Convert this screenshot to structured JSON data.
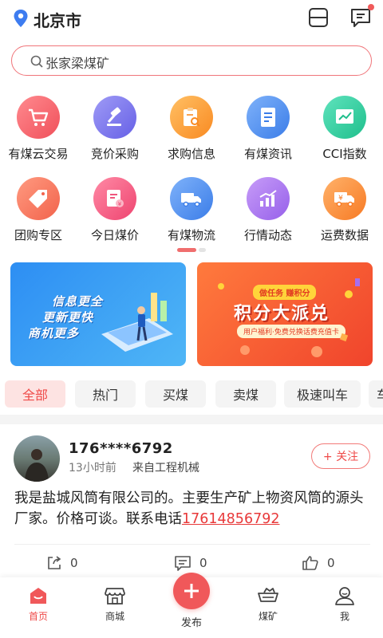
{
  "header": {
    "city": "北京市"
  },
  "search": {
    "text": "张家梁煤矿"
  },
  "grid": [
    {
      "label": "有煤云交易",
      "icon": "cart-icon",
      "color": "#f2616a"
    },
    {
      "label": "竞价采购",
      "icon": "gavel-icon",
      "color": "#7b75ee"
    },
    {
      "label": "求购信息",
      "icon": "clipboard-search-icon",
      "color": "#fb9b37"
    },
    {
      "label": "有煤资讯",
      "icon": "document-icon",
      "color": "#4f8ff0"
    },
    {
      "label": "CCI指数",
      "icon": "chart-window-icon",
      "color": "#2fcf9f"
    },
    {
      "label": "团购专区",
      "icon": "tag-icon",
      "color": "#f7775f"
    },
    {
      "label": "今日煤价",
      "icon": "price-doc-icon",
      "color": "#f25a7c"
    },
    {
      "label": "有煤物流",
      "icon": "truck-icon",
      "color": "#4f8ff0"
    },
    {
      "label": "行情动态",
      "icon": "bar-chart-icon",
      "color": "#a66ef0"
    },
    {
      "label": "运费数据",
      "icon": "freight-truck-icon",
      "color": "#fb8a3a"
    }
  ],
  "banners": {
    "left": [
      "信息更全",
      "更新更快",
      "商机更多"
    ],
    "right": {
      "pill": "做任务 赚积分",
      "title": "积分大派兑",
      "sub": "用户福利·免费兑换话费充值卡"
    }
  },
  "tabs": [
    "全部",
    "热门",
    "买煤",
    "卖煤",
    "极速叫车",
    "车"
  ],
  "post": {
    "username": "176****6792",
    "time": "13小时前",
    "source": "来自工程机械",
    "follow": "+ 关注",
    "content": "我是盐城风筒有限公司的。主要生产矿上物资风筒的源头厂家。价格可谈。联系电话",
    "phone": "17614856792",
    "shares": "0",
    "comments": "0",
    "likes": "0"
  },
  "nav": {
    "home": "首页",
    "mall": "商城",
    "publish": "发布",
    "coalmine": "煤矿",
    "me": "我"
  }
}
